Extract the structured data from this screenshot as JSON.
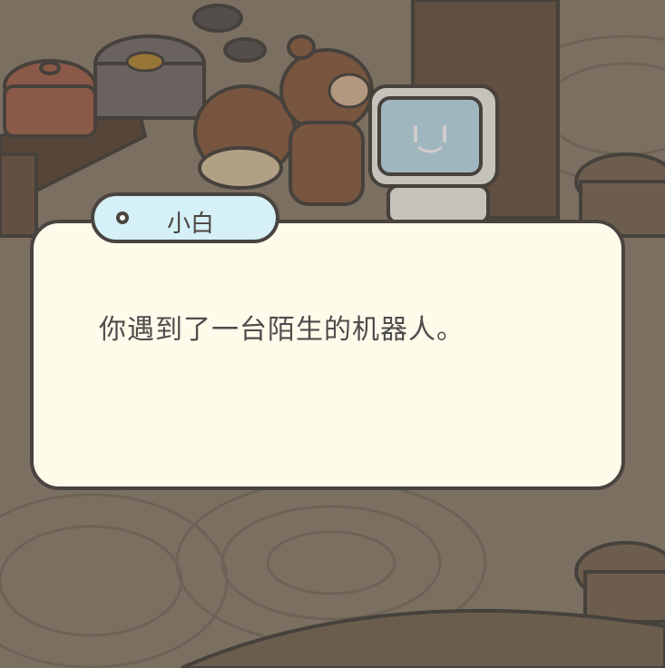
{
  "dialog": {
    "speaker": "小白",
    "text": "你遇到了一台陌生的机器人。"
  },
  "colors": {
    "dialog_background": "#fffbea",
    "name_tag_background": "#d5f0f6",
    "outline": "#4a4440",
    "text": "#4d4d4d",
    "scene_dim": "#8f8272"
  },
  "scene": {
    "icons": [
      "cooking-pot-icon",
      "stove-icon",
      "bear-character-icon",
      "robot-character-icon",
      "round-table-icon",
      "stool-icon"
    ]
  }
}
